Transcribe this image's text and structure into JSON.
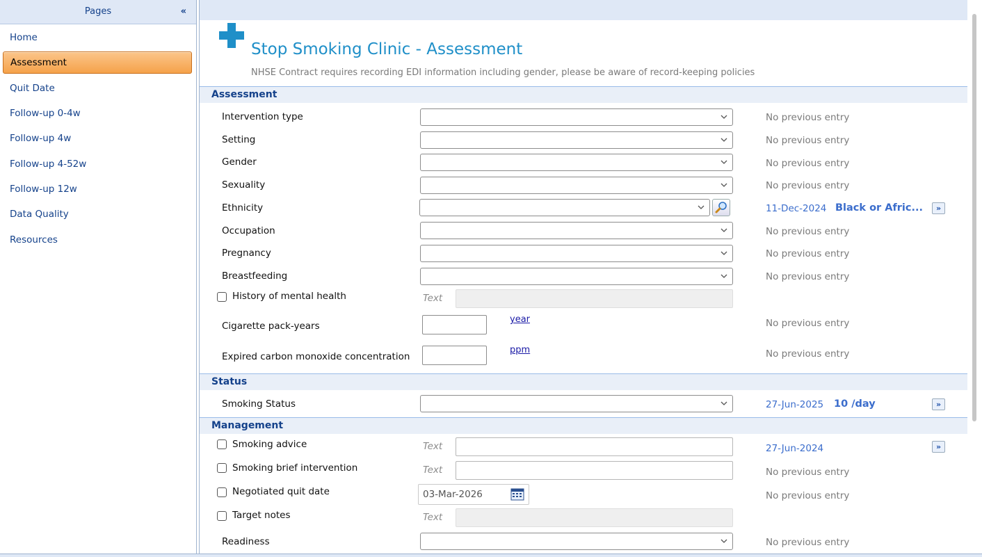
{
  "sidebar": {
    "title": "Pages",
    "collapse": "«",
    "items": [
      {
        "label": "Home"
      },
      {
        "label": "Assessment"
      },
      {
        "label": "Quit Date"
      },
      {
        "label": "Follow-up 0-4w"
      },
      {
        "label": "Follow-up 4w"
      },
      {
        "label": "Follow-up 4-52w"
      },
      {
        "label": "Follow-up 12w"
      },
      {
        "label": "Data Quality"
      },
      {
        "label": "Resources"
      }
    ],
    "active_index": 1
  },
  "header": {
    "title": "Stop Smoking Clinic - Assessment",
    "subtitle": "NHSE Contract requires recording EDI information including gender, please be aware of record-keeping policies",
    "logo_color": "#1f8fc8"
  },
  "common": {
    "no_previous": "No previous entry",
    "text_placeholder": "Text",
    "more": "»"
  },
  "assessment": {
    "heading": "Assessment",
    "fields": [
      {
        "label": "Intervention type",
        "value": ""
      },
      {
        "label": "Setting",
        "value": ""
      },
      {
        "label": "Gender",
        "value": ""
      },
      {
        "label": "Sexuality",
        "value": ""
      },
      {
        "label": "Ethnicity",
        "value": "",
        "prev_date": "11-Dec-2024",
        "prev_value": "Black or Afric..."
      },
      {
        "label": "Occupation",
        "value": ""
      },
      {
        "label": "Pregnancy",
        "value": ""
      },
      {
        "label": "Breastfeeding",
        "value": ""
      }
    ],
    "mental_health_label": "History of mental health",
    "pack_years": {
      "label": "Cigarette pack-years",
      "unit": "year",
      "value": ""
    },
    "co": {
      "label": "Expired carbon monoxide concentration",
      "unit": "ppm",
      "value": ""
    }
  },
  "status": {
    "heading": "Status",
    "smoking_status": {
      "label": "Smoking Status",
      "value": "",
      "prev_date": "27-Jun-2025",
      "prev_value": "10 /day"
    }
  },
  "management": {
    "heading": "Management",
    "smoking_advice": {
      "label": "Smoking advice",
      "prev_date": "27-Jun-2024"
    },
    "brief_intervention": {
      "label": "Smoking brief intervention"
    },
    "quit_date": {
      "label": "Negotiated quit date",
      "value": "03-Mar-2026"
    },
    "target_notes": {
      "label": "Target notes"
    },
    "readiness": {
      "label": "Readiness",
      "value": ""
    }
  },
  "colors": {
    "accent": "#15428b",
    "title_blue": "#1f8fc8",
    "active_orange": "#f5a24a",
    "link_blue": "#3b6dcc"
  }
}
